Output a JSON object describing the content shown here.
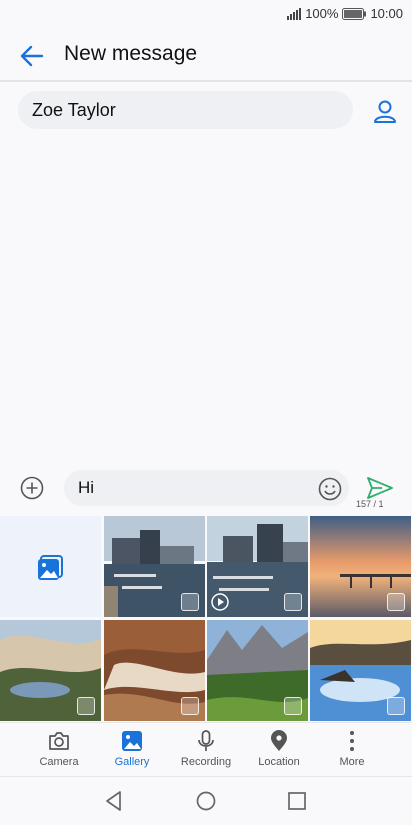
{
  "status": {
    "battery": "100%",
    "time": "10:00"
  },
  "header": {
    "title": "New message"
  },
  "recipient": {
    "name": "Zoe Taylor"
  },
  "compose": {
    "text": "Hi",
    "counter": "157 / 1"
  },
  "tabs": [
    {
      "label": "Camera"
    },
    {
      "label": "Gallery"
    },
    {
      "label": "Recording"
    },
    {
      "label": "Location"
    },
    {
      "label": "More"
    }
  ],
  "colors": {
    "accent": "#1a73d9",
    "send": "#2fae6b"
  }
}
